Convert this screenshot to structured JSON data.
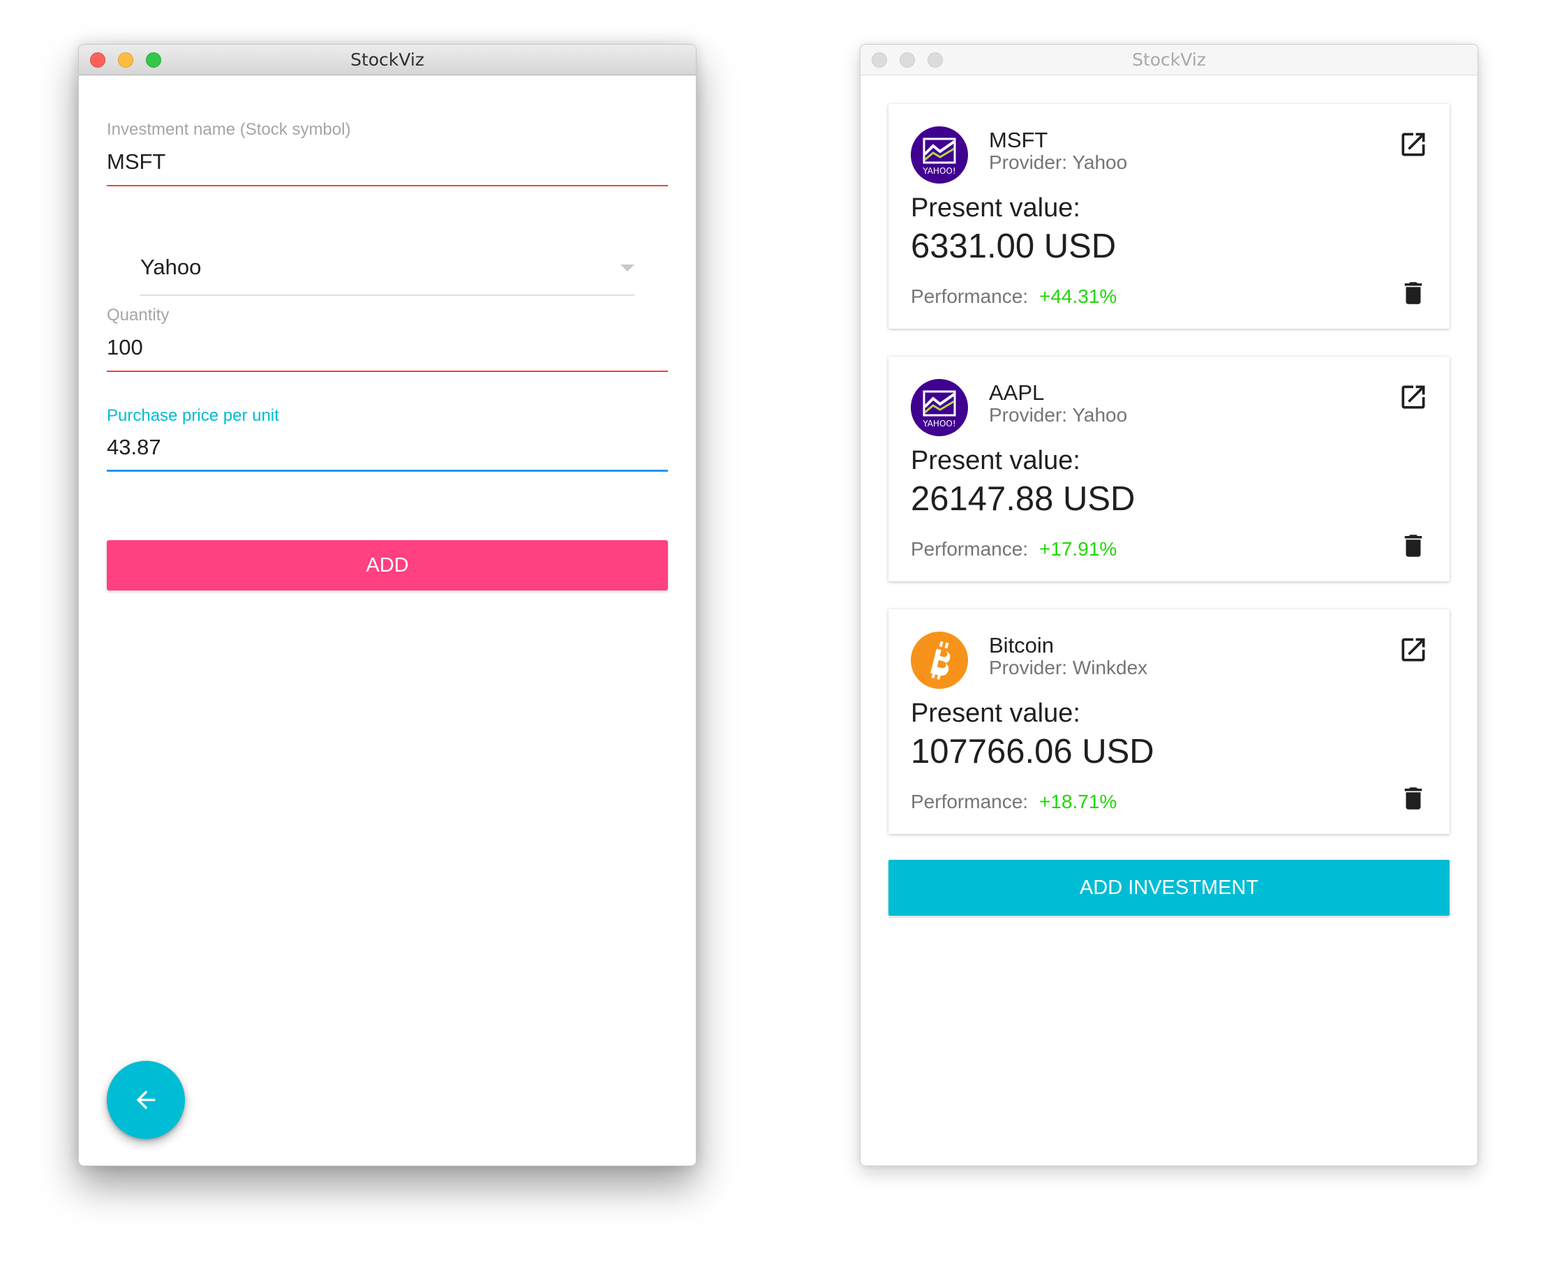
{
  "left_window": {
    "title": "StockViz",
    "form": {
      "name_label": "Investment name (Stock symbol)",
      "name_value": "MSFT",
      "provider_value": "Yahoo",
      "quantity_label": "Quantity",
      "quantity_value": "100",
      "price_label": "Purchase price per unit",
      "price_value": "43.87",
      "add_label": "ADD"
    },
    "fab_icon": "arrow-left-icon"
  },
  "right_window": {
    "title": "StockViz",
    "present_value_label": "Present value:",
    "performance_label": "Performance:",
    "investments": [
      {
        "name": "MSFT",
        "provider": "Provider: Yahoo",
        "value": "6331.00 USD",
        "performance": "+44.31%",
        "logo": "yahoo-logo"
      },
      {
        "name": "AAPL",
        "provider": "Provider: Yahoo",
        "value": "26147.88 USD",
        "performance": "+17.91%",
        "logo": "yahoo-logo"
      },
      {
        "name": "Bitcoin",
        "provider": "Provider: Winkdex",
        "value": "107766.06 USD",
        "performance": "+18.71%",
        "logo": "bitcoin-logo"
      }
    ],
    "logo_text": "YAHOO!",
    "add_investment_label": "ADD INVESTMENT"
  },
  "colors": {
    "accent_pink": "#ff4081",
    "primary_cyan": "#00bcd4",
    "error_red": "#f44336",
    "focus_blue": "#2196f3",
    "performance_green": "#1ed900",
    "yahoo_purple": "#400090",
    "bitcoin_orange": "#f7931a"
  }
}
